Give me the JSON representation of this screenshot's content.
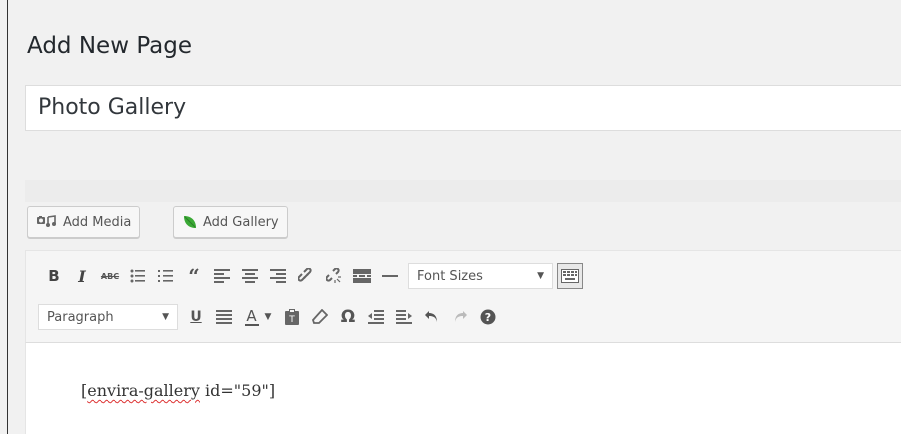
{
  "page": {
    "heading": "Add New Page",
    "title_value": "Photo Gallery"
  },
  "media_buttons": {
    "add_media": "Add Media",
    "add_gallery": "Add Gallery"
  },
  "toolbar": {
    "row1": [
      {
        "name": "bold-icon",
        "glyph": "B"
      },
      {
        "name": "italic-icon",
        "glyph": "I"
      },
      {
        "name": "strikethrough-icon",
        "glyph": "ABC"
      },
      {
        "name": "bullet-list-icon"
      },
      {
        "name": "numbered-list-icon"
      },
      {
        "name": "blockquote-icon",
        "glyph": "66"
      },
      {
        "name": "align-left-icon"
      },
      {
        "name": "align-center-icon"
      },
      {
        "name": "align-right-icon"
      },
      {
        "name": "link-icon"
      },
      {
        "name": "unlink-icon"
      },
      {
        "name": "read-more-icon"
      },
      {
        "name": "horizontal-line-icon"
      }
    ],
    "font_sizes_label": "Font Sizes",
    "paragraph_label": "Paragraph",
    "row2": [
      {
        "name": "underline-icon",
        "glyph": "U"
      },
      {
        "name": "justify-icon"
      },
      {
        "name": "text-color-icon",
        "glyph": "A"
      },
      {
        "name": "paste-text-icon"
      },
      {
        "name": "clear-formatting-icon"
      },
      {
        "name": "special-character-icon",
        "glyph": "Ω"
      },
      {
        "name": "outdent-icon"
      },
      {
        "name": "indent-icon"
      },
      {
        "name": "undo-icon"
      },
      {
        "name": "redo-icon"
      },
      {
        "name": "help-icon",
        "glyph": "?"
      }
    ]
  },
  "editor": {
    "shortcode_spelled": "envira-gallery",
    "shortcode_open": "[",
    "shortcode_rest": " id=\"59\"]"
  },
  "colors": {
    "gallery_leaf": "#3aa935",
    "text": "#23282d",
    "icon": "#555555"
  }
}
